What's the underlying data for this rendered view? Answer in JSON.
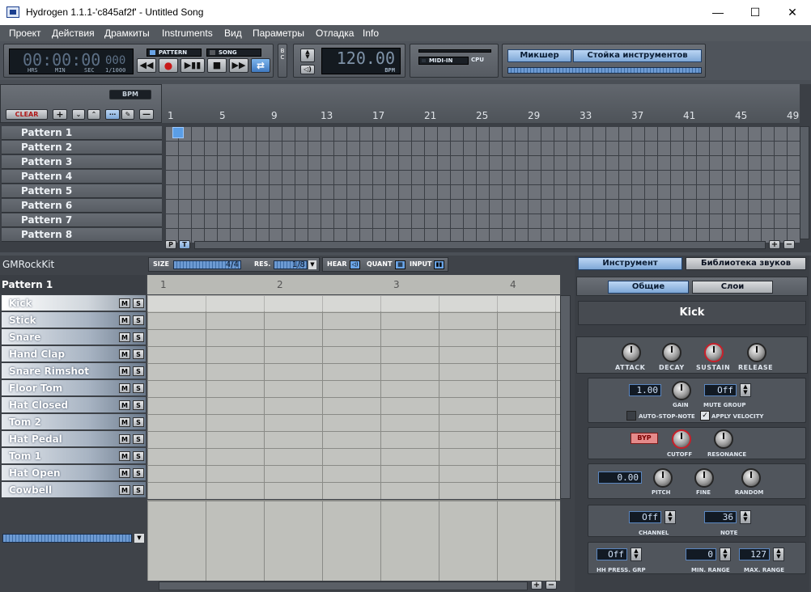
{
  "window": {
    "title": "Hydrogen 1.1.1-'c845af2f' - Untitled Song",
    "minimize": "—",
    "maximize": "☐",
    "close": "✕"
  },
  "menu": [
    "Проект",
    "Действия",
    "Драмкиты",
    "Instruments",
    "Вид",
    "Параметры",
    "Отладка",
    "Info"
  ],
  "transport": {
    "time": "00:00:00",
    "frames": "000",
    "unit_hrs": "HRS",
    "unit_min": "MIN",
    "unit_sec": "SEC",
    "unit_ms": "1/1000",
    "mode_pattern": "PATTERN",
    "mode_song": "SONG",
    "bc": "B C"
  },
  "bpm": {
    "value": "120.00",
    "label": "BPM"
  },
  "midi": {
    "midi_in": "MIDI-IN",
    "cpu": "CPU"
  },
  "top_tabs": {
    "mixer": "Микшер",
    "rack": "Стойка инструментов"
  },
  "song": {
    "bpm_button": "BPM",
    "clear": "CLEAR",
    "add": "+",
    "ruler": [
      "1",
      "5",
      "9",
      "13",
      "17",
      "21",
      "25",
      "29",
      "33",
      "37",
      "41",
      "45",
      "49"
    ],
    "patterns": [
      "Pattern 1",
      "Pattern 2",
      "Pattern 3",
      "Pattern 4",
      "Pattern 5",
      "Pattern 6",
      "Pattern 7",
      "Pattern 8"
    ],
    "p_btn": "P",
    "t_btn": "T"
  },
  "pattern_editor": {
    "kit": "GMRockKit",
    "pattern": "Pattern 1",
    "size_label": "SIZE",
    "size": "4/4",
    "res_label": "RES.",
    "res": "1/8",
    "hear": "HEAR",
    "quant": "QUANT",
    "input": "INPUT",
    "ruler": [
      "1",
      "2",
      "3",
      "4"
    ],
    "instruments": [
      "Kick",
      "Stick",
      "Snare",
      "Hand Clap",
      "Snare Rimshot",
      "Floor Tom",
      "Hat Closed",
      "Tom 2",
      "Hat Pedal",
      "Tom 1",
      "Hat Open",
      "Cowbell"
    ],
    "mute": "M",
    "solo": "S"
  },
  "instrument_panel": {
    "tab_instrument": "Инструмент",
    "tab_library": "Библиотека звуков",
    "tab_general": "Общие",
    "tab_layers": "Слои",
    "name": "Kick",
    "attack": "ATTACK",
    "decay": "DECAY",
    "sustain": "SUSTAIN",
    "release": "RELEASE",
    "gain_value": "1.00",
    "gain": "GAIN",
    "mute_group_value": "Off",
    "mute_group": "MUTE GROUP",
    "auto_stop": "AUTO-STOP-NOTE",
    "apply_velocity": "APPLY VELOCITY",
    "filter_btn": "BYP",
    "cutoff": "CUTOFF",
    "resonance": "RESONANCE",
    "pitch_value": "0.00",
    "pitch": "PITCH",
    "fine": "FINE",
    "random": "RANDOM",
    "channel_value": "Off",
    "channel": "CHANNEL",
    "note_value": "36",
    "note": "NOTE",
    "hh_value": "Off",
    "hh": "HH PRESS. GRP",
    "min_value": "0",
    "min_range": "MIN. RANGE",
    "max_value": "127",
    "max_range": "MAX. RANGE"
  }
}
